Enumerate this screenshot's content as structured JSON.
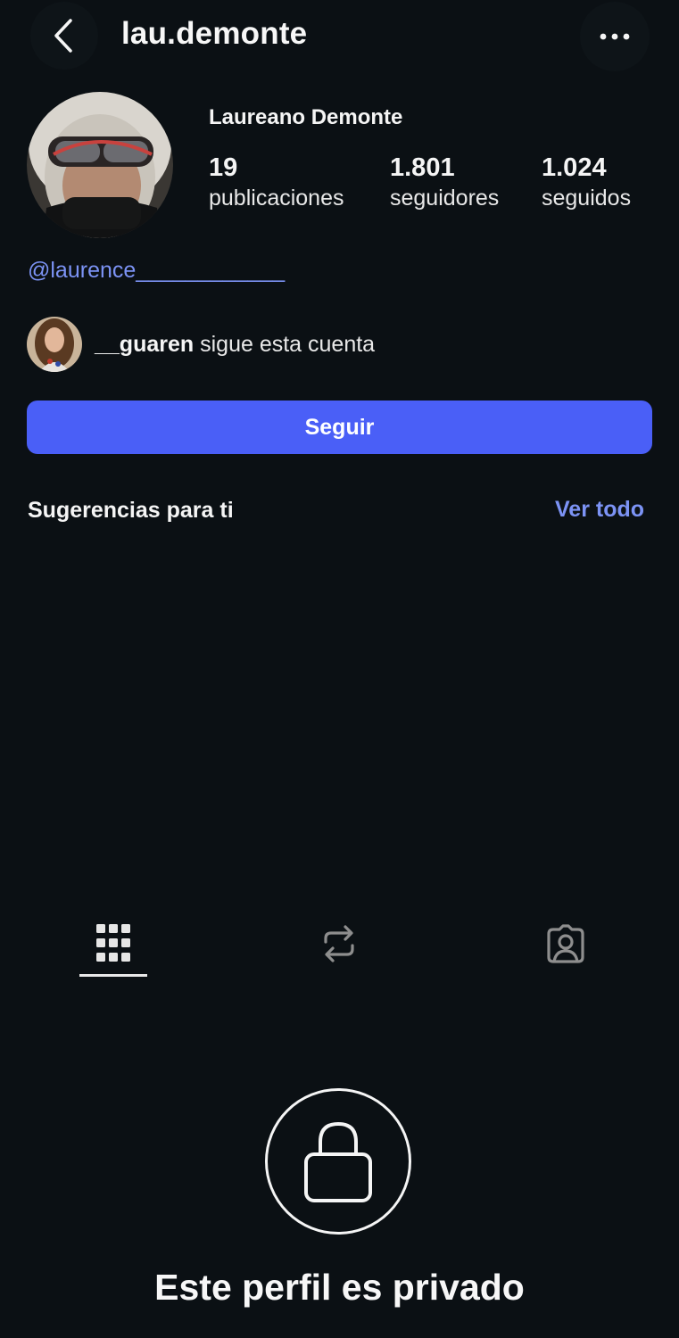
{
  "header": {
    "title": "lau.demonte",
    "back_icon": "chevron-left-icon",
    "more_icon": "ellipsis-icon"
  },
  "profile": {
    "full_name": "Laureano Demonte",
    "stats": [
      {
        "value": "19",
        "label": "publicaciones"
      },
      {
        "value": "1.801",
        "label": "seguidores"
      },
      {
        "value": "1.024",
        "label": "seguidos"
      }
    ],
    "bio_link": "@laurence____________"
  },
  "followed_by": {
    "username": "__guaren",
    "text": " sigue esta cuenta"
  },
  "follow_button": {
    "label": "Seguir"
  },
  "suggestions": {
    "title": "Sugerencias para ti",
    "see_all": "Ver todo"
  },
  "tabs": [
    {
      "icon": "grid-icon",
      "active": true
    },
    {
      "icon": "reposts-icon",
      "active": false
    },
    {
      "icon": "tagged-icon",
      "active": false
    }
  ],
  "private_notice": {
    "icon": "lock-icon",
    "title": "Este perfil es privado"
  },
  "colors": {
    "background": "#0b1014",
    "accent_button": "#4a5ff7",
    "link": "#7c93f5"
  }
}
